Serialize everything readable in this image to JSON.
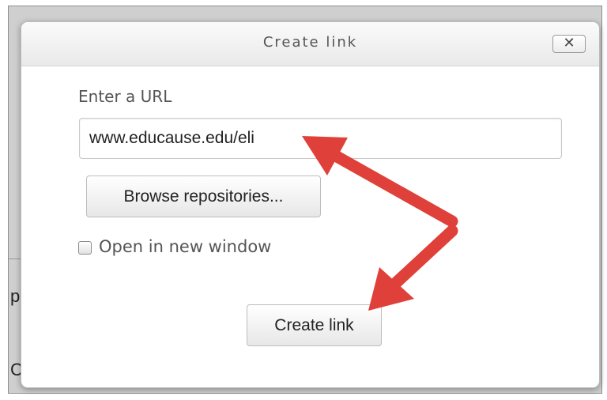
{
  "background": {
    "partial_chars": [
      "p",
      "C"
    ]
  },
  "dialog": {
    "title": "Create link",
    "close_label": "✕",
    "url_label": "Enter a URL",
    "url_value": "www.educause.edu/eli",
    "browse_label": "Browse repositories...",
    "checkbox_label": "Open in new window",
    "checkbox_checked": false,
    "submit_label": "Create link"
  },
  "annotation": {
    "arrow_color": "#e0403a"
  }
}
